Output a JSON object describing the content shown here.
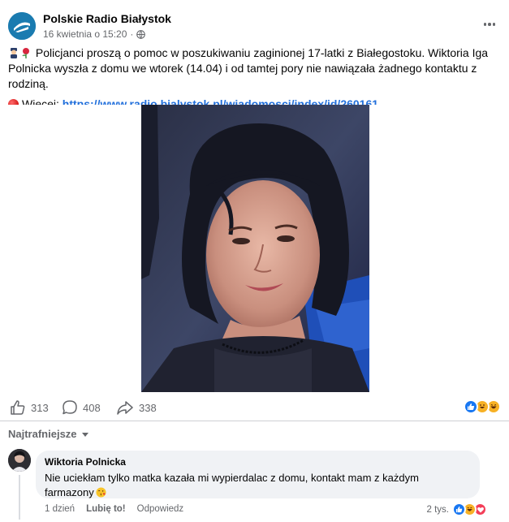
{
  "post": {
    "page_name": "Polskie Radio Białystok",
    "timestamp": "16 kwietnia o 15:20",
    "separator": "·",
    "text_main": "Policjanci proszą o pomoc w poszukiwaniu zaginionej 17-latki z Białegostoku. Wiktoria Iga Polnicka wyszła z domu we wtorek (14.04) i od tamtej pory nie nawiązała żadnego kontaktu z rodziną.",
    "more_label": "Więcej:",
    "link": "https://www.radio.bialystok.pl/wiadomosci/index/id/260161",
    "icons": [
      "globe-icon",
      "more-icon",
      "police-officer-emoji",
      "rose-emoji",
      "red-circle-emoji"
    ]
  },
  "stats": {
    "likes": "313",
    "comments": "408",
    "shares": "338",
    "reactions": [
      "like",
      "laugh",
      "laugh"
    ]
  },
  "sort": {
    "label": "Najtrafniejsze"
  },
  "comment": {
    "author": "Wiktoria Polnicka",
    "text": "Nie uciekłam tylko matka kazała mi wypierdalac z domu, kontakt mam z każdym farmazony",
    "age": "1 dzień",
    "like_label": "Lubię to!",
    "reply_label": "Odpowiedz",
    "reaction_count": "2 tys.",
    "reactions": [
      "like",
      "laugh",
      "love"
    ]
  },
  "colors": {
    "link": "#216fdb",
    "like_blue": "#1877f2",
    "text_secondary": "#65676b",
    "bubble": "#f0f2f5"
  }
}
